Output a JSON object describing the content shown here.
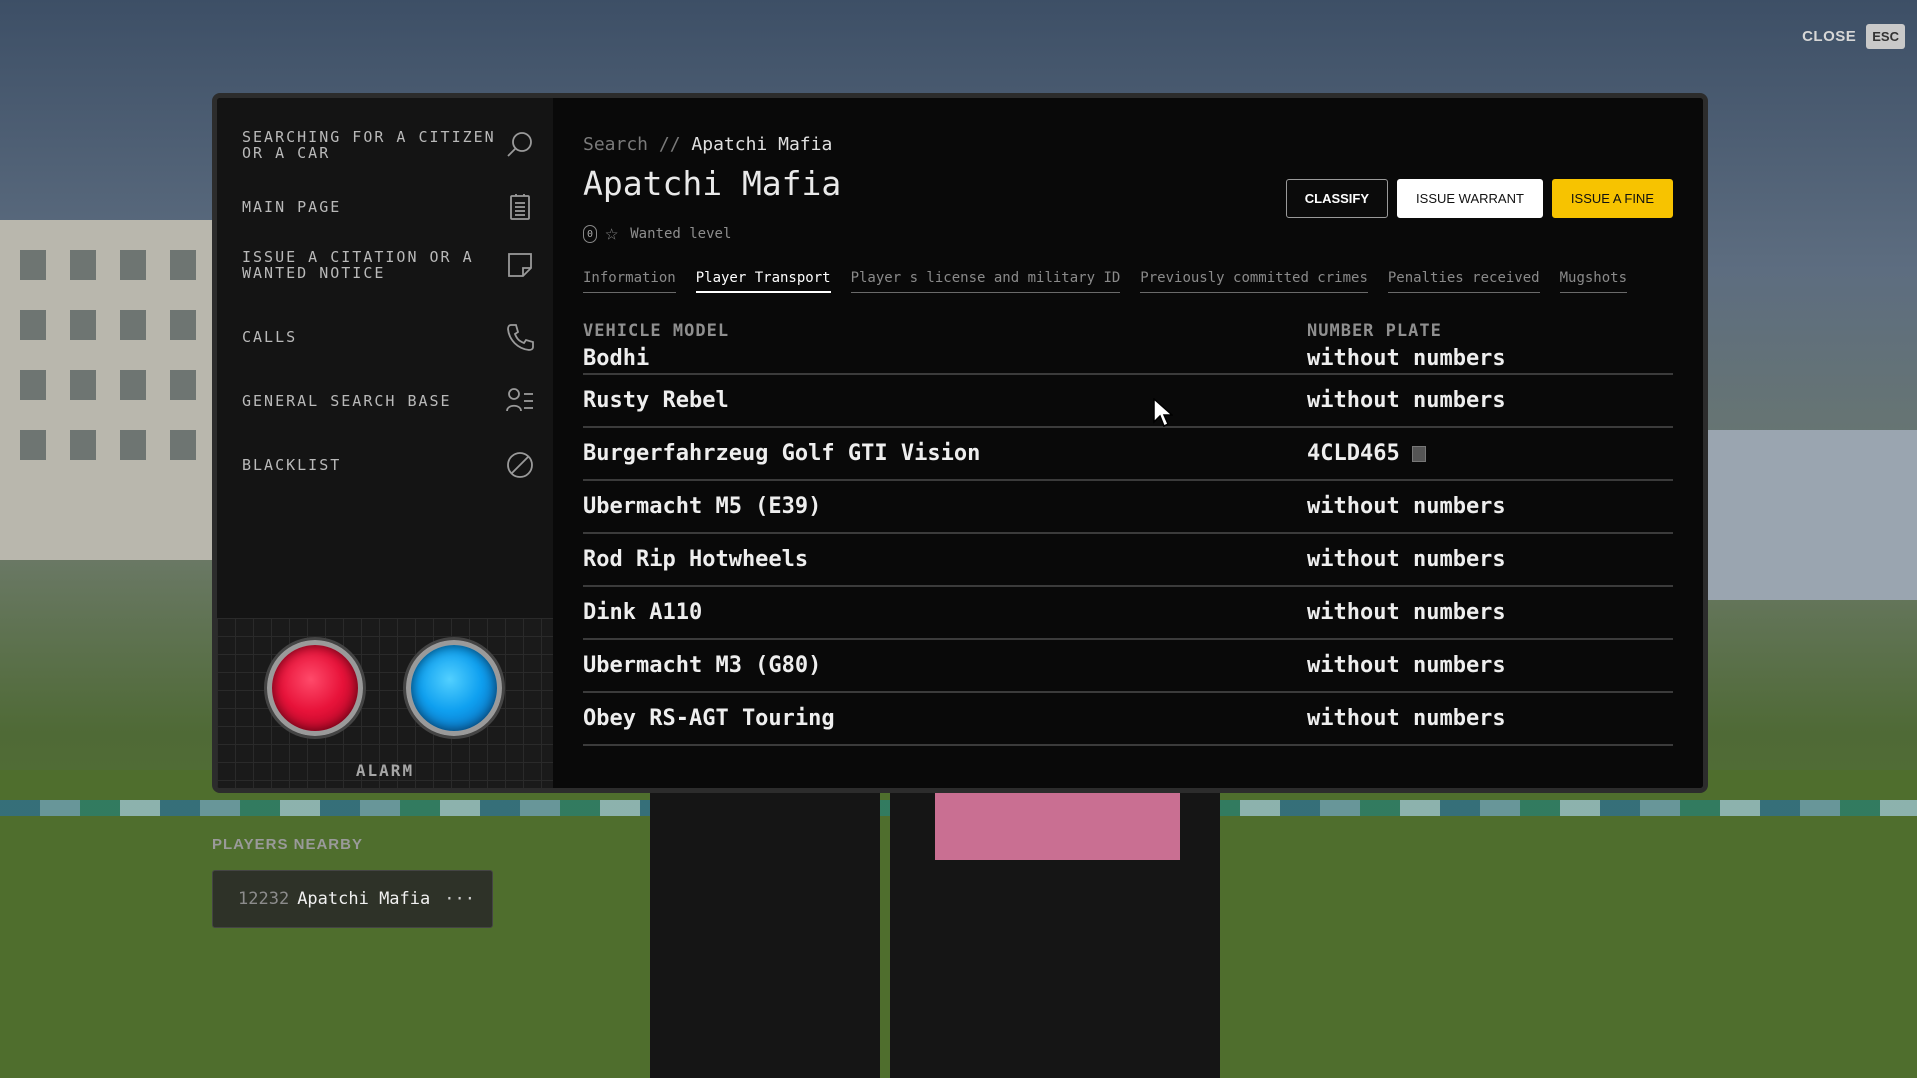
{
  "close": {
    "label": "CLOSE",
    "key": "ESC"
  },
  "sidebar": {
    "items": [
      {
        "label": "SEARCHING FOR A CITIZEN\nOR A CAR",
        "icon": "search-icon"
      },
      {
        "label": "MAIN PAGE",
        "icon": "clipboard-icon"
      },
      {
        "label": "ISSUE A CITATION OR A WANTED NOTICE",
        "icon": "note-icon"
      },
      {
        "label": "CALLS",
        "icon": "phone-icon"
      },
      {
        "label": "GENERAL SEARCH BASE",
        "icon": "user-list-icon"
      },
      {
        "label": "BLACKLIST",
        "icon": "ban-icon"
      }
    ],
    "alarm_label": "ALARM"
  },
  "breadcrumb": {
    "root": "Search",
    "separator": "//",
    "current": "Apatchi Mafia"
  },
  "person": {
    "name": "Apatchi Mafia",
    "wanted_count": "0",
    "wanted_label": "Wanted level"
  },
  "actions": {
    "classify": "CLASSIFY",
    "warrant": "ISSUE WARRANT",
    "fine": "ISSUE A FINE"
  },
  "tabs": [
    {
      "label": "Information",
      "active": false
    },
    {
      "label": "Player Transport",
      "active": true
    },
    {
      "label": "Player s license and military ID",
      "active": false
    },
    {
      "label": "Previously committed crimes",
      "active": false
    },
    {
      "label": "Penalties received",
      "active": false
    },
    {
      "label": "Mugshots",
      "active": false
    }
  ],
  "vehicles": {
    "headers": {
      "model": "VEHICLE MODEL",
      "plate": "NUMBER PLATE"
    },
    "rows": [
      {
        "model": "Bodhi",
        "plate": "without numbers"
      },
      {
        "model": "Rusty Rebel",
        "plate": "without numbers"
      },
      {
        "model": "Burgerfahrzeug Golf GTI Vision",
        "plate": "4CLD465",
        "copy": true
      },
      {
        "model": "Ubermacht M5 (E39)",
        "plate": "without numbers"
      },
      {
        "model": "Rod Rip Hotwheels",
        "plate": "without numbers"
      },
      {
        "model": "Dink A110",
        "plate": "without numbers"
      },
      {
        "model": "Ubermacht M3 (G80)",
        "plate": "without numbers"
      },
      {
        "model": "Obey RS-AGT Touring",
        "plate": "without numbers"
      }
    ]
  },
  "nearby": {
    "title": "PLAYERS NEARBY",
    "players": [
      {
        "id": "12232",
        "name": "Apatchi Mafia",
        "more": "···"
      }
    ]
  },
  "colors": {
    "accent": "#f7c300",
    "alarm_red": "#e8133a",
    "alarm_blue": "#0fa0f0"
  }
}
